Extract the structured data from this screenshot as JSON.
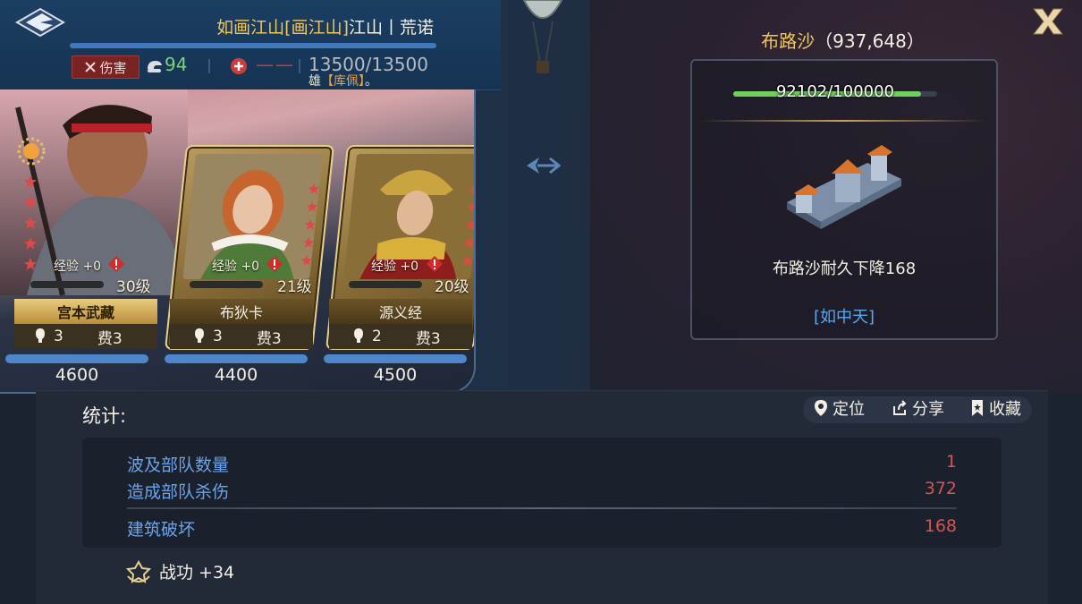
{
  "header": {
    "owner_name": "如画江山[画江山]",
    "owner_location": "江山丨荒诺",
    "damage_label": "伤害",
    "morale": "94",
    "heal": "——",
    "troops": "13500/13500",
    "note_prefix": "雄",
    "note_highlight": "【库佩】",
    "note_suffix": "。"
  },
  "heroes": [
    {
      "name": "宫本武藏",
      "exp": "经验 +0",
      "level": "30级",
      "token": "3",
      "cost": "费3",
      "hp": "4600",
      "stars": 5
    },
    {
      "name": "布狄卡",
      "exp": "经验 +0",
      "level": "21级",
      "token": "3",
      "cost": "费3",
      "hp": "4400",
      "stars": 5
    },
    {
      "name": "源义经",
      "exp": "经验 +0",
      "level": "20级",
      "token": "2",
      "cost": "费3",
      "hp": "4500",
      "stars": 5
    }
  ],
  "target": {
    "name": "布路沙",
    "coords": "（937,648）",
    "durability_text": "92102/100000",
    "durability_fraction": 0.92102,
    "durability_drop": "布路沙耐久下降168",
    "alliance": "[如中天]"
  },
  "stats": {
    "label": "统计:",
    "actions": {
      "locate": "定位",
      "share": "分享",
      "favorite": "收藏"
    },
    "rows": [
      {
        "label": "波及部队数量",
        "value": "1"
      },
      {
        "label": "造成部队杀伤",
        "value": "372"
      },
      {
        "label": "建筑破坏",
        "value": "168"
      }
    ],
    "merit": "战功 +34"
  },
  "colors": {
    "gold": "#f2c75a",
    "accent_blue": "#6ea3e6",
    "danger": "#d9534f",
    "green": "#6fd05c"
  },
  "icons": [
    "back-icon",
    "close-icon",
    "sword-icon",
    "morale-icon",
    "heal-icon",
    "arrow-icon",
    "balloon-icon",
    "location-icon",
    "share-icon",
    "bookmark-icon",
    "merit-icon",
    "star-icon"
  ]
}
